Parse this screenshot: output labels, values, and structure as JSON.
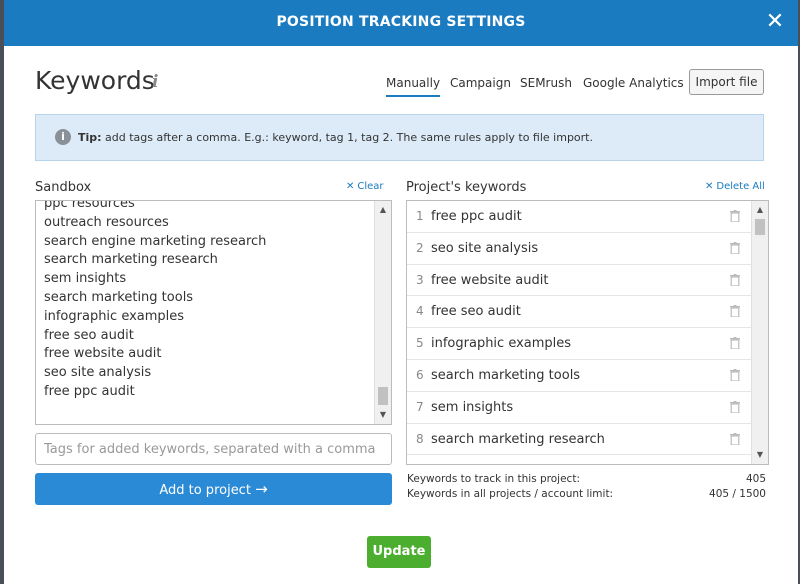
{
  "header": {
    "title": "POSITION TRACKING SETTINGS",
    "close_glyph": "✕"
  },
  "keywords": {
    "title": "Keywords",
    "info_glyph": "i"
  },
  "tabs": [
    {
      "label": "Manually",
      "active": true
    },
    {
      "label": "Campaign",
      "active": false
    },
    {
      "label": "SEMrush",
      "active": false
    },
    {
      "label": "Google Analytics",
      "active": false
    }
  ],
  "import_label": "Import file",
  "tip": {
    "icon_glyph": "i",
    "bold": "Tip:",
    "text": " add tags after a comma. E.g.: keyword, tag 1, tag 2. The same rules apply to file import."
  },
  "sandbox": {
    "label": "Sandbox",
    "clear_label": "Clear",
    "lines": [
      "ppc resources",
      "outreach resources",
      "search engine marketing research",
      "search marketing research",
      "sem insights",
      "search marketing tools",
      "infographic examples",
      "free seo audit",
      "free website audit",
      "seo site analysis",
      "free ppc audit"
    ],
    "tags_placeholder": "Tags for added keywords, separated with a comma",
    "add_label": "Add to project",
    "add_arrow": "→"
  },
  "project": {
    "label": "Project's keywords",
    "delete_all_label": "Delete All",
    "rows": [
      {
        "num": "1",
        "keyword": "free ppc audit"
      },
      {
        "num": "2",
        "keyword": "seo site analysis"
      },
      {
        "num": "3",
        "keyword": "free website audit"
      },
      {
        "num": "4",
        "keyword": "free seo audit"
      },
      {
        "num": "5",
        "keyword": "infographic examples"
      },
      {
        "num": "6",
        "keyword": "search marketing tools"
      },
      {
        "num": "7",
        "keyword": "sem insights"
      },
      {
        "num": "8",
        "keyword": "search marketing research"
      }
    ]
  },
  "stats": {
    "track_label": "Keywords to track in this project:",
    "track_value": "405",
    "limit_label": "Keywords in all projects / account limit:",
    "limit_value": "405 / 1500"
  },
  "update_label": "Update",
  "colors": {
    "header": "#1a7bc0",
    "primary": "#2b8ad6",
    "success": "#4cae2f",
    "tip_bg": "#dcebf7"
  }
}
